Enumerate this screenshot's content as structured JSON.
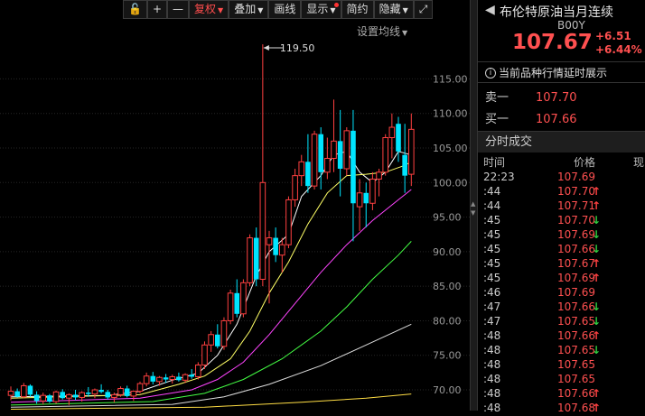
{
  "toolbar": {
    "buttons": [
      {
        "id": "lock",
        "label": "🔓"
      },
      {
        "id": "zoom-in",
        "label": "+"
      },
      {
        "id": "zoom-out",
        "label": "—"
      },
      {
        "id": "adjust",
        "label": "复权"
      },
      {
        "id": "overlay",
        "label": "叠加"
      },
      {
        "id": "draw",
        "label": "画线"
      },
      {
        "id": "display",
        "label": "显示"
      },
      {
        "id": "simple",
        "label": "简约"
      },
      {
        "id": "hide",
        "label": "隐藏"
      },
      {
        "id": "fullscreen",
        "label": "⤢"
      }
    ]
  },
  "ma_settings_label": "设置均线",
  "max_annotation": "119.50",
  "side_panel": {
    "name": "布伦特原油当月连续",
    "code": "B00Y",
    "last_price": "107.67",
    "change_abs": "+6.51",
    "change_pct": "+6.44%",
    "notice_icon": "i",
    "notice": "当前品种行情延时展示",
    "ask_label": "卖一",
    "ask_price": "107.70",
    "bid_label": "买一",
    "bid_price": "107.66",
    "ticks_title": "分时成交",
    "col_time": "时间",
    "col_price": "价格",
    "col_vol": "现"
  },
  "ticks": [
    {
      "time": "22:23",
      "price": "107.69",
      "dir": ""
    },
    {
      "time": ":44",
      "price": "107.70",
      "dir": "up"
    },
    {
      "time": ":44",
      "price": "107.71",
      "dir": "up"
    },
    {
      "time": ":45",
      "price": "107.70",
      "dir": "down"
    },
    {
      "time": ":45",
      "price": "107.69",
      "dir": "down"
    },
    {
      "time": ":45",
      "price": "107.66",
      "dir": "down"
    },
    {
      "time": ":45",
      "price": "107.67",
      "dir": "up"
    },
    {
      "time": ":45",
      "price": "107.69",
      "dir": "up"
    },
    {
      "time": ":46",
      "price": "107.69",
      "dir": ""
    },
    {
      "time": ":47",
      "price": "107.66",
      "dir": "down"
    },
    {
      "time": ":47",
      "price": "107.65",
      "dir": "down"
    },
    {
      "time": ":48",
      "price": "107.66",
      "dir": "up"
    },
    {
      "time": ":48",
      "price": "107.65",
      "dir": "down"
    },
    {
      "time": ":48",
      "price": "107.65",
      "dir": ""
    },
    {
      "time": ":48",
      "price": "107.65",
      "dir": ""
    },
    {
      "time": ":48",
      "price": "107.66",
      "dir": "up"
    },
    {
      "time": ":48",
      "price": "107.68",
      "dir": "up"
    }
  ],
  "colors": {
    "up": "#ff4040",
    "down": "#2ecc40",
    "cyan": "#00e5ff",
    "ma5": "#ffffff",
    "ma10": "#ffff66",
    "ma20": "#ff44ff",
    "ma40": "#44ff44",
    "ma60": "#dddddd",
    "ma120": "#ffdd44"
  },
  "chart_data": {
    "type": "candlestick",
    "y_ticks": [
      115,
      110,
      105,
      100,
      95,
      90,
      85,
      80,
      75,
      70
    ],
    "ylim": [
      67,
      122.5
    ],
    "annotation": {
      "label": "119.50",
      "value": 119.5
    },
    "candles": [
      [
        69.2,
        70.5,
        68.5,
        69.8
      ],
      [
        69.8,
        70.2,
        68.9,
        69.0
      ],
      [
        69.0,
        71.0,
        68.8,
        70.6
      ],
      [
        70.6,
        70.8,
        69.0,
        69.3
      ],
      [
        69.3,
        69.8,
        68.0,
        68.4
      ],
      [
        68.4,
        69.6,
        67.9,
        69.2
      ],
      [
        69.2,
        69.4,
        68.1,
        68.3
      ],
      [
        68.3,
        69.9,
        68.0,
        69.7
      ],
      [
        69.7,
        70.1,
        68.6,
        68.8
      ],
      [
        68.8,
        69.5,
        67.8,
        69.3
      ],
      [
        69.3,
        70.0,
        68.5,
        68.9
      ],
      [
        68.9,
        69.8,
        68.3,
        69.6
      ],
      [
        69.6,
        70.4,
        69.0,
        69.4
      ],
      [
        69.4,
        70.2,
        68.8,
        70.0
      ],
      [
        70.0,
        70.8,
        69.5,
        69.7
      ],
      [
        69.7,
        70.0,
        68.6,
        68.9
      ],
      [
        68.9,
        69.6,
        68.2,
        69.3
      ],
      [
        69.3,
        70.5,
        69.0,
        70.2
      ],
      [
        70.2,
        70.6,
        68.9,
        69.1
      ],
      [
        69.1,
        69.9,
        68.4,
        69.8
      ],
      [
        69.8,
        71.2,
        69.5,
        70.9
      ],
      [
        70.9,
        72.5,
        70.5,
        72.0
      ],
      [
        72.0,
        72.6,
        70.8,
        71.2
      ],
      [
        71.2,
        72.0,
        70.6,
        71.8
      ],
      [
        71.8,
        72.3,
        71.0,
        71.5
      ],
      [
        71.5,
        72.2,
        70.9,
        71.9
      ],
      [
        71.9,
        72.5,
        71.2,
        71.4
      ],
      [
        71.4,
        72.4,
        71.0,
        72.2
      ],
      [
        72.2,
        73.0,
        71.6,
        71.9
      ],
      [
        71.9,
        74.0,
        71.5,
        73.6
      ],
      [
        73.6,
        77.0,
        73.0,
        76.5
      ],
      [
        76.5,
        78.5,
        75.5,
        78.0
      ],
      [
        78.0,
        79.5,
        76.0,
        76.3
      ],
      [
        76.3,
        80.5,
        75.8,
        80.0
      ],
      [
        80.0,
        84.5,
        79.5,
        84.0
      ],
      [
        84.0,
        86.0,
        80.5,
        81.0
      ],
      [
        81.0,
        86.0,
        80.5,
        85.5
      ],
      [
        85.5,
        92.5,
        85.0,
        92.0
      ],
      [
        92.0,
        93.5,
        85.0,
        86.0
      ],
      [
        86.0,
        120.0,
        85.0,
        100.0
      ],
      [
        91.0,
        93.0,
        82.5,
        92.0
      ],
      [
        92.0,
        93.5,
        88.5,
        89.5
      ],
      [
        89.5,
        92.0,
        87.0,
        91.0
      ],
      [
        91.0,
        98.0,
        90.5,
        97.5
      ],
      [
        97.5,
        102.0,
        96.5,
        101.0
      ],
      [
        101.0,
        104.0,
        99.5,
        103.0
      ],
      [
        103.0,
        107.0,
        98.5,
        99.5
      ],
      [
        99.5,
        107.5,
        99.0,
        107.0
      ],
      [
        107.0,
        108.0,
        99.0,
        101.5
      ],
      [
        101.5,
        106.5,
        100.5,
        103.5
      ],
      [
        103.5,
        112.0,
        101.5,
        106.0
      ],
      [
        106.0,
        110.5,
        98.0,
        102.0
      ],
      [
        102.0,
        108.0,
        101.0,
        107.5
      ],
      [
        107.5,
        110.5,
        91.5,
        97.0
      ],
      [
        96.5,
        100.5,
        93.0,
        98.5
      ],
      [
        98.5,
        100.0,
        93.5,
        97.0
      ],
      [
        97.0,
        101.5,
        96.0,
        100.5
      ],
      [
        100.5,
        102.0,
        98.0,
        101.5
      ],
      [
        101.5,
        107.0,
        101.0,
        106.5
      ],
      [
        106.5,
        110.0,
        103.5,
        108.0
      ],
      [
        108.5,
        109.5,
        103.0,
        104.5
      ],
      [
        104.0,
        108.5,
        98.5,
        101.0
      ],
      [
        101.2,
        110.0,
        99.5,
        107.7
      ]
    ],
    "ma_lines": [
      {
        "name": "MA5",
        "color": "#ffffff",
        "points": [
          [
            0,
            69.0
          ],
          [
            15,
            69.2
          ],
          [
            20,
            69.8
          ],
          [
            25,
            71.4
          ],
          [
            29,
            72.4
          ],
          [
            32,
            75.0
          ],
          [
            35,
            79.5
          ],
          [
            38,
            86.5
          ],
          [
            40,
            90.0
          ],
          [
            43,
            92.5
          ],
          [
            45,
            98.0
          ],
          [
            48,
            101.0
          ],
          [
            50,
            104.0
          ],
          [
            52,
            104.5
          ],
          [
            54,
            101.5
          ],
          [
            56,
            100.0
          ],
          [
            58,
            101.5
          ],
          [
            60,
            104.5
          ],
          [
            62,
            104.0
          ]
        ]
      },
      {
        "name": "MA10",
        "color": "#ffff66",
        "points": [
          [
            0,
            68.8
          ],
          [
            20,
            69.3
          ],
          [
            26,
            70.8
          ],
          [
            30,
            72.0
          ],
          [
            34,
            74.5
          ],
          [
            37,
            78.5
          ],
          [
            40,
            84.0
          ],
          [
            43,
            88.5
          ],
          [
            46,
            94.0
          ],
          [
            49,
            98.5
          ],
          [
            52,
            101.0
          ],
          [
            55,
            101.2
          ],
          [
            58,
            101.5
          ],
          [
            61,
            102.5
          ],
          [
            62,
            103.0
          ]
        ]
      },
      {
        "name": "MA20",
        "color": "#ff44ff",
        "points": [
          [
            0,
            68.2
          ],
          [
            20,
            68.8
          ],
          [
            28,
            70.0
          ],
          [
            32,
            71.5
          ],
          [
            36,
            74.0
          ],
          [
            40,
            78.0
          ],
          [
            44,
            82.5
          ],
          [
            48,
            87.0
          ],
          [
            52,
            91.0
          ],
          [
            56,
            94.5
          ],
          [
            60,
            97.5
          ],
          [
            62,
            99.0
          ]
        ]
      },
      {
        "name": "MA40",
        "color": "#44ff44",
        "points": [
          [
            0,
            67.8
          ],
          [
            22,
            68.3
          ],
          [
            30,
            69.5
          ],
          [
            36,
            71.5
          ],
          [
            42,
            74.5
          ],
          [
            48,
            78.5
          ],
          [
            52,
            82.0
          ],
          [
            56,
            86.0
          ],
          [
            60,
            89.5
          ],
          [
            62,
            91.5
          ]
        ]
      },
      {
        "name": "MA60",
        "color": "#dddddd",
        "points": [
          [
            0,
            67.5
          ],
          [
            25,
            67.9
          ],
          [
            33,
            69.0
          ],
          [
            40,
            70.8
          ],
          [
            48,
            73.5
          ],
          [
            55,
            76.5
          ],
          [
            62,
            79.5
          ]
        ]
      },
      {
        "name": "MA120",
        "color": "#ffdd44",
        "points": [
          [
            0,
            67.2
          ],
          [
            30,
            67.5
          ],
          [
            45,
            68.2
          ],
          [
            55,
            68.8
          ],
          [
            62,
            69.4
          ]
        ]
      }
    ]
  }
}
